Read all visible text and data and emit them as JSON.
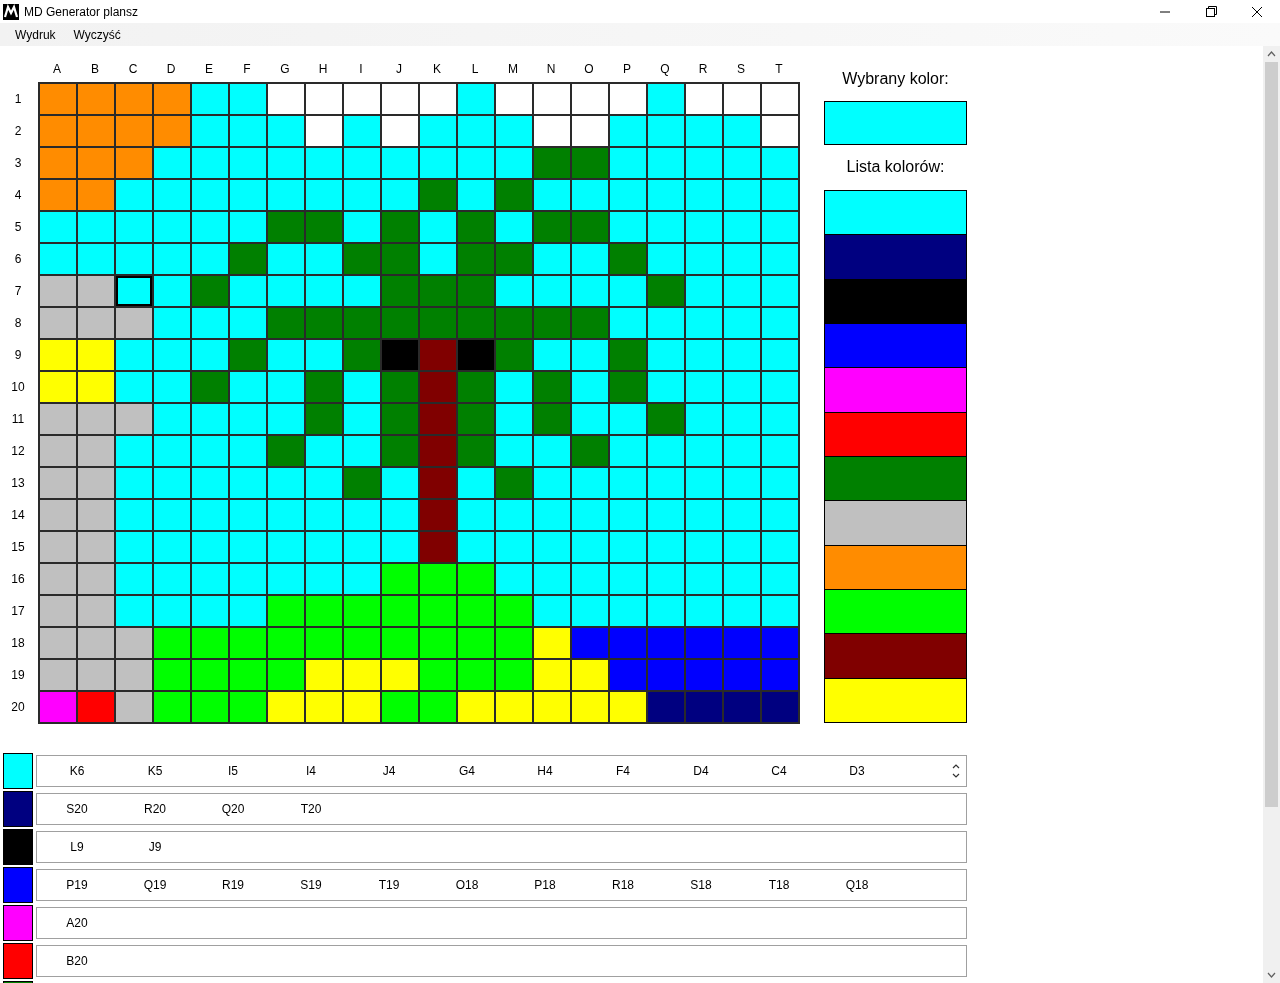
{
  "window": {
    "title": "MD Generator plansz"
  },
  "menu": [
    {
      "label": "Wydruk"
    },
    {
      "label": "Wyczyść"
    }
  ],
  "board": {
    "columns": [
      "A",
      "B",
      "C",
      "D",
      "E",
      "F",
      "G",
      "H",
      "I",
      "J",
      "K",
      "L",
      "M",
      "N",
      "O",
      "P",
      "Q",
      "R",
      "S",
      "T"
    ],
    "rows": [
      {
        "label": "1",
        "cells": [
          {
            "color": "#ff8c00",
            "selected": false
          },
          {
            "color": "#ff8c00",
            "selected": false
          },
          {
            "color": "#ff8c00",
            "selected": false
          },
          {
            "color": "#ff8c00",
            "selected": false
          },
          {
            "color": "#00ffff",
            "selected": false
          },
          {
            "color": "#00ffff",
            "selected": false
          },
          {
            "color": "#ffffff",
            "selected": false
          },
          {
            "color": "#ffffff",
            "selected": false
          },
          {
            "color": "#ffffff",
            "selected": false
          },
          {
            "color": "#ffffff",
            "selected": false
          },
          {
            "color": "#ffffff",
            "selected": false
          },
          {
            "color": "#00ffff",
            "selected": false
          },
          {
            "color": "#ffffff",
            "selected": false
          },
          {
            "color": "#ffffff",
            "selected": false
          },
          {
            "color": "#ffffff",
            "selected": false
          },
          {
            "color": "#ffffff",
            "selected": false
          },
          {
            "color": "#00ffff",
            "selected": false
          },
          {
            "color": "#ffffff",
            "selected": false
          },
          {
            "color": "#ffffff",
            "selected": false
          },
          {
            "color": "#ffffff",
            "selected": false
          }
        ]
      },
      {
        "label": "2",
        "cells": [
          {
            "color": "#ff8c00",
            "selected": false
          },
          {
            "color": "#ff8c00",
            "selected": false
          },
          {
            "color": "#ff8c00",
            "selected": false
          },
          {
            "color": "#ff8c00",
            "selected": false
          },
          {
            "color": "#00ffff",
            "selected": false
          },
          {
            "color": "#00ffff",
            "selected": false
          },
          {
            "color": "#00ffff",
            "selected": false
          },
          {
            "color": "#ffffff",
            "selected": false
          },
          {
            "color": "#00ffff",
            "selected": false
          },
          {
            "color": "#ffffff",
            "selected": false
          },
          {
            "color": "#00ffff",
            "selected": false
          },
          {
            "color": "#00ffff",
            "selected": false
          },
          {
            "color": "#00ffff",
            "selected": false
          },
          {
            "color": "#ffffff",
            "selected": false
          },
          {
            "color": "#ffffff",
            "selected": false
          },
          {
            "color": "#00ffff",
            "selected": false
          },
          {
            "color": "#00ffff",
            "selected": false
          },
          {
            "color": "#00ffff",
            "selected": false
          },
          {
            "color": "#00ffff",
            "selected": false
          },
          {
            "color": "#ffffff",
            "selected": false
          }
        ]
      },
      {
        "label": "3",
        "cells": [
          {
            "color": "#ff8c00",
            "selected": false
          },
          {
            "color": "#ff8c00",
            "selected": false
          },
          {
            "color": "#ff8c00",
            "selected": false
          },
          {
            "color": "#00ffff",
            "selected": false
          },
          {
            "color": "#00ffff",
            "selected": false
          },
          {
            "color": "#00ffff",
            "selected": false
          },
          {
            "color": "#00ffff",
            "selected": false
          },
          {
            "color": "#00ffff",
            "selected": false
          },
          {
            "color": "#00ffff",
            "selected": false
          },
          {
            "color": "#00ffff",
            "selected": false
          },
          {
            "color": "#00ffff",
            "selected": false
          },
          {
            "color": "#00ffff",
            "selected": false
          },
          {
            "color": "#00ffff",
            "selected": false
          },
          {
            "color": "#008000",
            "selected": false
          },
          {
            "color": "#008000",
            "selected": false
          },
          {
            "color": "#00ffff",
            "selected": false
          },
          {
            "color": "#00ffff",
            "selected": false
          },
          {
            "color": "#00ffff",
            "selected": false
          },
          {
            "color": "#00ffff",
            "selected": false
          },
          {
            "color": "#00ffff",
            "selected": false
          }
        ]
      },
      {
        "label": "4",
        "cells": [
          {
            "color": "#ff8c00",
            "selected": false
          },
          {
            "color": "#ff8c00",
            "selected": false
          },
          {
            "color": "#00ffff",
            "selected": false
          },
          {
            "color": "#00ffff",
            "selected": false
          },
          {
            "color": "#00ffff",
            "selected": false
          },
          {
            "color": "#00ffff",
            "selected": false
          },
          {
            "color": "#00ffff",
            "selected": false
          },
          {
            "color": "#00ffff",
            "selected": false
          },
          {
            "color": "#00ffff",
            "selected": false
          },
          {
            "color": "#00ffff",
            "selected": false
          },
          {
            "color": "#008000",
            "selected": false
          },
          {
            "color": "#00ffff",
            "selected": false
          },
          {
            "color": "#008000",
            "selected": false
          },
          {
            "color": "#00ffff",
            "selected": false
          },
          {
            "color": "#00ffff",
            "selected": false
          },
          {
            "color": "#00ffff",
            "selected": false
          },
          {
            "color": "#00ffff",
            "selected": false
          },
          {
            "color": "#00ffff",
            "selected": false
          },
          {
            "color": "#00ffff",
            "selected": false
          },
          {
            "color": "#00ffff",
            "selected": false
          }
        ]
      },
      {
        "label": "5",
        "cells": [
          {
            "color": "#00ffff",
            "selected": false
          },
          {
            "color": "#00ffff",
            "selected": false
          },
          {
            "color": "#00ffff",
            "selected": false
          },
          {
            "color": "#00ffff",
            "selected": false
          },
          {
            "color": "#00ffff",
            "selected": false
          },
          {
            "color": "#00ffff",
            "selected": false
          },
          {
            "color": "#008000",
            "selected": false
          },
          {
            "color": "#008000",
            "selected": false
          },
          {
            "color": "#00ffff",
            "selected": false
          },
          {
            "color": "#008000",
            "selected": false
          },
          {
            "color": "#00ffff",
            "selected": false
          },
          {
            "color": "#008000",
            "selected": false
          },
          {
            "color": "#00ffff",
            "selected": false
          },
          {
            "color": "#008000",
            "selected": false
          },
          {
            "color": "#008000",
            "selected": false
          },
          {
            "color": "#00ffff",
            "selected": false
          },
          {
            "color": "#00ffff",
            "selected": false
          },
          {
            "color": "#00ffff",
            "selected": false
          },
          {
            "color": "#00ffff",
            "selected": false
          },
          {
            "color": "#00ffff",
            "selected": false
          }
        ]
      },
      {
        "label": "6",
        "cells": [
          {
            "color": "#00ffff",
            "selected": false
          },
          {
            "color": "#00ffff",
            "selected": false
          },
          {
            "color": "#00ffff",
            "selected": false
          },
          {
            "color": "#00ffff",
            "selected": false
          },
          {
            "color": "#00ffff",
            "selected": false
          },
          {
            "color": "#008000",
            "selected": false
          },
          {
            "color": "#00ffff",
            "selected": false
          },
          {
            "color": "#00ffff",
            "selected": false
          },
          {
            "color": "#008000",
            "selected": false
          },
          {
            "color": "#008000",
            "selected": false
          },
          {
            "color": "#00ffff",
            "selected": false
          },
          {
            "color": "#008000",
            "selected": false
          },
          {
            "color": "#008000",
            "selected": false
          },
          {
            "color": "#00ffff",
            "selected": false
          },
          {
            "color": "#00ffff",
            "selected": false
          },
          {
            "color": "#008000",
            "selected": false
          },
          {
            "color": "#00ffff",
            "selected": false
          },
          {
            "color": "#00ffff",
            "selected": false
          },
          {
            "color": "#00ffff",
            "selected": false
          },
          {
            "color": "#00ffff",
            "selected": false
          }
        ]
      },
      {
        "label": "7",
        "cells": [
          {
            "color": "#c0c0c0",
            "selected": false
          },
          {
            "color": "#c0c0c0",
            "selected": false
          },
          {
            "color": "#00ffff",
            "selected": true
          },
          {
            "color": "#00ffff",
            "selected": false
          },
          {
            "color": "#008000",
            "selected": false
          },
          {
            "color": "#00ffff",
            "selected": false
          },
          {
            "color": "#00ffff",
            "selected": false
          },
          {
            "color": "#00ffff",
            "selected": false
          },
          {
            "color": "#00ffff",
            "selected": false
          },
          {
            "color": "#008000",
            "selected": false
          },
          {
            "color": "#008000",
            "selected": false
          },
          {
            "color": "#008000",
            "selected": false
          },
          {
            "color": "#00ffff",
            "selected": false
          },
          {
            "color": "#00ffff",
            "selected": false
          },
          {
            "color": "#00ffff",
            "selected": false
          },
          {
            "color": "#00ffff",
            "selected": false
          },
          {
            "color": "#008000",
            "selected": false
          },
          {
            "color": "#00ffff",
            "selected": false
          },
          {
            "color": "#00ffff",
            "selected": false
          },
          {
            "color": "#00ffff",
            "selected": false
          }
        ]
      },
      {
        "label": "8",
        "cells": [
          {
            "color": "#c0c0c0",
            "selected": false
          },
          {
            "color": "#c0c0c0",
            "selected": false
          },
          {
            "color": "#c0c0c0",
            "selected": false
          },
          {
            "color": "#00ffff",
            "selected": false
          },
          {
            "color": "#00ffff",
            "selected": false
          },
          {
            "color": "#00ffff",
            "selected": false
          },
          {
            "color": "#008000",
            "selected": false
          },
          {
            "color": "#008000",
            "selected": false
          },
          {
            "color": "#008000",
            "selected": false
          },
          {
            "color": "#008000",
            "selected": false
          },
          {
            "color": "#008000",
            "selected": false
          },
          {
            "color": "#008000",
            "selected": false
          },
          {
            "color": "#008000",
            "selected": false
          },
          {
            "color": "#008000",
            "selected": false
          },
          {
            "color": "#008000",
            "selected": false
          },
          {
            "color": "#00ffff",
            "selected": false
          },
          {
            "color": "#00ffff",
            "selected": false
          },
          {
            "color": "#00ffff",
            "selected": false
          },
          {
            "color": "#00ffff",
            "selected": false
          },
          {
            "color": "#00ffff",
            "selected": false
          }
        ]
      },
      {
        "label": "9",
        "cells": [
          {
            "color": "#ffff00",
            "selected": false
          },
          {
            "color": "#ffff00",
            "selected": false
          },
          {
            "color": "#00ffff",
            "selected": false
          },
          {
            "color": "#00ffff",
            "selected": false
          },
          {
            "color": "#00ffff",
            "selected": false
          },
          {
            "color": "#008000",
            "selected": false
          },
          {
            "color": "#00ffff",
            "selected": false
          },
          {
            "color": "#00ffff",
            "selected": false
          },
          {
            "color": "#008000",
            "selected": false
          },
          {
            "color": "#000000",
            "selected": false
          },
          {
            "color": "#800000",
            "selected": false
          },
          {
            "color": "#000000",
            "selected": false
          },
          {
            "color": "#008000",
            "selected": false
          },
          {
            "color": "#00ffff",
            "selected": false
          },
          {
            "color": "#00ffff",
            "selected": false
          },
          {
            "color": "#008000",
            "selected": false
          },
          {
            "color": "#00ffff",
            "selected": false
          },
          {
            "color": "#00ffff",
            "selected": false
          },
          {
            "color": "#00ffff",
            "selected": false
          },
          {
            "color": "#00ffff",
            "selected": false
          }
        ]
      },
      {
        "label": "10",
        "cells": [
          {
            "color": "#ffff00",
            "selected": false
          },
          {
            "color": "#ffff00",
            "selected": false
          },
          {
            "color": "#00ffff",
            "selected": false
          },
          {
            "color": "#00ffff",
            "selected": false
          },
          {
            "color": "#008000",
            "selected": false
          },
          {
            "color": "#00ffff",
            "selected": false
          },
          {
            "color": "#00ffff",
            "selected": false
          },
          {
            "color": "#008000",
            "selected": false
          },
          {
            "color": "#00ffff",
            "selected": false
          },
          {
            "color": "#008000",
            "selected": false
          },
          {
            "color": "#800000",
            "selected": false
          },
          {
            "color": "#008000",
            "selected": false
          },
          {
            "color": "#00ffff",
            "selected": false
          },
          {
            "color": "#008000",
            "selected": false
          },
          {
            "color": "#00ffff",
            "selected": false
          },
          {
            "color": "#008000",
            "selected": false
          },
          {
            "color": "#00ffff",
            "selected": false
          },
          {
            "color": "#00ffff",
            "selected": false
          },
          {
            "color": "#00ffff",
            "selected": false
          },
          {
            "color": "#00ffff",
            "selected": false
          }
        ]
      },
      {
        "label": "11",
        "cells": [
          {
            "color": "#c0c0c0",
            "selected": false
          },
          {
            "color": "#c0c0c0",
            "selected": false
          },
          {
            "color": "#c0c0c0",
            "selected": false
          },
          {
            "color": "#00ffff",
            "selected": false
          },
          {
            "color": "#00ffff",
            "selected": false
          },
          {
            "color": "#00ffff",
            "selected": false
          },
          {
            "color": "#00ffff",
            "selected": false
          },
          {
            "color": "#008000",
            "selected": false
          },
          {
            "color": "#00ffff",
            "selected": false
          },
          {
            "color": "#008000",
            "selected": false
          },
          {
            "color": "#800000",
            "selected": false
          },
          {
            "color": "#008000",
            "selected": false
          },
          {
            "color": "#00ffff",
            "selected": false
          },
          {
            "color": "#008000",
            "selected": false
          },
          {
            "color": "#00ffff",
            "selected": false
          },
          {
            "color": "#00ffff",
            "selected": false
          },
          {
            "color": "#008000",
            "selected": false
          },
          {
            "color": "#00ffff",
            "selected": false
          },
          {
            "color": "#00ffff",
            "selected": false
          },
          {
            "color": "#00ffff",
            "selected": false
          }
        ]
      },
      {
        "label": "12",
        "cells": [
          {
            "color": "#c0c0c0",
            "selected": false
          },
          {
            "color": "#c0c0c0",
            "selected": false
          },
          {
            "color": "#00ffff",
            "selected": false
          },
          {
            "color": "#00ffff",
            "selected": false
          },
          {
            "color": "#00ffff",
            "selected": false
          },
          {
            "color": "#00ffff",
            "selected": false
          },
          {
            "color": "#008000",
            "selected": false
          },
          {
            "color": "#00ffff",
            "selected": false
          },
          {
            "color": "#00ffff",
            "selected": false
          },
          {
            "color": "#008000",
            "selected": false
          },
          {
            "color": "#800000",
            "selected": false
          },
          {
            "color": "#008000",
            "selected": false
          },
          {
            "color": "#00ffff",
            "selected": false
          },
          {
            "color": "#00ffff",
            "selected": false
          },
          {
            "color": "#008000",
            "selected": false
          },
          {
            "color": "#00ffff",
            "selected": false
          },
          {
            "color": "#00ffff",
            "selected": false
          },
          {
            "color": "#00ffff",
            "selected": false
          },
          {
            "color": "#00ffff",
            "selected": false
          },
          {
            "color": "#00ffff",
            "selected": false
          }
        ]
      },
      {
        "label": "13",
        "cells": [
          {
            "color": "#c0c0c0",
            "selected": false
          },
          {
            "color": "#c0c0c0",
            "selected": false
          },
          {
            "color": "#00ffff",
            "selected": false
          },
          {
            "color": "#00ffff",
            "selected": false
          },
          {
            "color": "#00ffff",
            "selected": false
          },
          {
            "color": "#00ffff",
            "selected": false
          },
          {
            "color": "#00ffff",
            "selected": false
          },
          {
            "color": "#00ffff",
            "selected": false
          },
          {
            "color": "#008000",
            "selected": false
          },
          {
            "color": "#00ffff",
            "selected": false
          },
          {
            "color": "#800000",
            "selected": false
          },
          {
            "color": "#00ffff",
            "selected": false
          },
          {
            "color": "#008000",
            "selected": false
          },
          {
            "color": "#00ffff",
            "selected": false
          },
          {
            "color": "#00ffff",
            "selected": false
          },
          {
            "color": "#00ffff",
            "selected": false
          },
          {
            "color": "#00ffff",
            "selected": false
          },
          {
            "color": "#00ffff",
            "selected": false
          },
          {
            "color": "#00ffff",
            "selected": false
          },
          {
            "color": "#00ffff",
            "selected": false
          }
        ]
      },
      {
        "label": "14",
        "cells": [
          {
            "color": "#c0c0c0",
            "selected": false
          },
          {
            "color": "#c0c0c0",
            "selected": false
          },
          {
            "color": "#00ffff",
            "selected": false
          },
          {
            "color": "#00ffff",
            "selected": false
          },
          {
            "color": "#00ffff",
            "selected": false
          },
          {
            "color": "#00ffff",
            "selected": false
          },
          {
            "color": "#00ffff",
            "selected": false
          },
          {
            "color": "#00ffff",
            "selected": false
          },
          {
            "color": "#00ffff",
            "selected": false
          },
          {
            "color": "#00ffff",
            "selected": false
          },
          {
            "color": "#800000",
            "selected": false
          },
          {
            "color": "#00ffff",
            "selected": false
          },
          {
            "color": "#00ffff",
            "selected": false
          },
          {
            "color": "#00ffff",
            "selected": false
          },
          {
            "color": "#00ffff",
            "selected": false
          },
          {
            "color": "#00ffff",
            "selected": false
          },
          {
            "color": "#00ffff",
            "selected": false
          },
          {
            "color": "#00ffff",
            "selected": false
          },
          {
            "color": "#00ffff",
            "selected": false
          },
          {
            "color": "#00ffff",
            "selected": false
          }
        ]
      },
      {
        "label": "15",
        "cells": [
          {
            "color": "#c0c0c0",
            "selected": false
          },
          {
            "color": "#c0c0c0",
            "selected": false
          },
          {
            "color": "#00ffff",
            "selected": false
          },
          {
            "color": "#00ffff",
            "selected": false
          },
          {
            "color": "#00ffff",
            "selected": false
          },
          {
            "color": "#00ffff",
            "selected": false
          },
          {
            "color": "#00ffff",
            "selected": false
          },
          {
            "color": "#00ffff",
            "selected": false
          },
          {
            "color": "#00ffff",
            "selected": false
          },
          {
            "color": "#00ffff",
            "selected": false
          },
          {
            "color": "#800000",
            "selected": false
          },
          {
            "color": "#00ffff",
            "selected": false
          },
          {
            "color": "#00ffff",
            "selected": false
          },
          {
            "color": "#00ffff",
            "selected": false
          },
          {
            "color": "#00ffff",
            "selected": false
          },
          {
            "color": "#00ffff",
            "selected": false
          },
          {
            "color": "#00ffff",
            "selected": false
          },
          {
            "color": "#00ffff",
            "selected": false
          },
          {
            "color": "#00ffff",
            "selected": false
          },
          {
            "color": "#00ffff",
            "selected": false
          }
        ]
      },
      {
        "label": "16",
        "cells": [
          {
            "color": "#c0c0c0",
            "selected": false
          },
          {
            "color": "#c0c0c0",
            "selected": false
          },
          {
            "color": "#00ffff",
            "selected": false
          },
          {
            "color": "#00ffff",
            "selected": false
          },
          {
            "color": "#00ffff",
            "selected": false
          },
          {
            "color": "#00ffff",
            "selected": false
          },
          {
            "color": "#00ffff",
            "selected": false
          },
          {
            "color": "#00ffff",
            "selected": false
          },
          {
            "color": "#00ffff",
            "selected": false
          },
          {
            "color": "#00ff00",
            "selected": false
          },
          {
            "color": "#00ff00",
            "selected": false
          },
          {
            "color": "#00ff00",
            "selected": false
          },
          {
            "color": "#00ffff",
            "selected": false
          },
          {
            "color": "#00ffff",
            "selected": false
          },
          {
            "color": "#00ffff",
            "selected": false
          },
          {
            "color": "#00ffff",
            "selected": false
          },
          {
            "color": "#00ffff",
            "selected": false
          },
          {
            "color": "#00ffff",
            "selected": false
          },
          {
            "color": "#00ffff",
            "selected": false
          },
          {
            "color": "#00ffff",
            "selected": false
          }
        ]
      },
      {
        "label": "17",
        "cells": [
          {
            "color": "#c0c0c0",
            "selected": false
          },
          {
            "color": "#c0c0c0",
            "selected": false
          },
          {
            "color": "#00ffff",
            "selected": false
          },
          {
            "color": "#00ffff",
            "selected": false
          },
          {
            "color": "#00ffff",
            "selected": false
          },
          {
            "color": "#00ffff",
            "selected": false
          },
          {
            "color": "#00ff00",
            "selected": false
          },
          {
            "color": "#00ff00",
            "selected": false
          },
          {
            "color": "#00ff00",
            "selected": false
          },
          {
            "color": "#00ff00",
            "selected": false
          },
          {
            "color": "#00ff00",
            "selected": false
          },
          {
            "color": "#00ff00",
            "selected": false
          },
          {
            "color": "#00ff00",
            "selected": false
          },
          {
            "color": "#00ffff",
            "selected": false
          },
          {
            "color": "#00ffff",
            "selected": false
          },
          {
            "color": "#00ffff",
            "selected": false
          },
          {
            "color": "#00ffff",
            "selected": false
          },
          {
            "color": "#00ffff",
            "selected": false
          },
          {
            "color": "#00ffff",
            "selected": false
          },
          {
            "color": "#00ffff",
            "selected": false
          }
        ]
      },
      {
        "label": "18",
        "cells": [
          {
            "color": "#c0c0c0",
            "selected": false
          },
          {
            "color": "#c0c0c0",
            "selected": false
          },
          {
            "color": "#c0c0c0",
            "selected": false
          },
          {
            "color": "#00ff00",
            "selected": false
          },
          {
            "color": "#00ff00",
            "selected": false
          },
          {
            "color": "#00ff00",
            "selected": false
          },
          {
            "color": "#00ff00",
            "selected": false
          },
          {
            "color": "#00ff00",
            "selected": false
          },
          {
            "color": "#00ff00",
            "selected": false
          },
          {
            "color": "#00ff00",
            "selected": false
          },
          {
            "color": "#00ff00",
            "selected": false
          },
          {
            "color": "#00ff00",
            "selected": false
          },
          {
            "color": "#00ff00",
            "selected": false
          },
          {
            "color": "#ffff00",
            "selected": false
          },
          {
            "color": "#0000ff",
            "selected": false
          },
          {
            "color": "#0000ff",
            "selected": false
          },
          {
            "color": "#0000ff",
            "selected": false
          },
          {
            "color": "#0000ff",
            "selected": false
          },
          {
            "color": "#0000ff",
            "selected": false
          },
          {
            "color": "#0000ff",
            "selected": false
          }
        ]
      },
      {
        "label": "19",
        "cells": [
          {
            "color": "#c0c0c0",
            "selected": false
          },
          {
            "color": "#c0c0c0",
            "selected": false
          },
          {
            "color": "#c0c0c0",
            "selected": false
          },
          {
            "color": "#00ff00",
            "selected": false
          },
          {
            "color": "#00ff00",
            "selected": false
          },
          {
            "color": "#00ff00",
            "selected": false
          },
          {
            "color": "#00ff00",
            "selected": false
          },
          {
            "color": "#ffff00",
            "selected": false
          },
          {
            "color": "#ffff00",
            "selected": false
          },
          {
            "color": "#ffff00",
            "selected": false
          },
          {
            "color": "#00ff00",
            "selected": false
          },
          {
            "color": "#00ff00",
            "selected": false
          },
          {
            "color": "#00ff00",
            "selected": false
          },
          {
            "color": "#ffff00",
            "selected": false
          },
          {
            "color": "#ffff00",
            "selected": false
          },
          {
            "color": "#0000ff",
            "selected": false
          },
          {
            "color": "#0000ff",
            "selected": false
          },
          {
            "color": "#0000ff",
            "selected": false
          },
          {
            "color": "#0000ff",
            "selected": false
          },
          {
            "color": "#0000ff",
            "selected": false
          }
        ]
      },
      {
        "label": "20",
        "cells": [
          {
            "color": "#ff00ff",
            "selected": false
          },
          {
            "color": "#ff0000",
            "selected": false
          },
          {
            "color": "#c0c0c0",
            "selected": false
          },
          {
            "color": "#00ff00",
            "selected": false
          },
          {
            "color": "#00ff00",
            "selected": false
          },
          {
            "color": "#00ff00",
            "selected": false
          },
          {
            "color": "#ffff00",
            "selected": false
          },
          {
            "color": "#ffff00",
            "selected": false
          },
          {
            "color": "#ffff00",
            "selected": false
          },
          {
            "color": "#00ff00",
            "selected": false
          },
          {
            "color": "#00ff00",
            "selected": false
          },
          {
            "color": "#ffff00",
            "selected": false
          },
          {
            "color": "#ffff00",
            "selected": false
          },
          {
            "color": "#ffff00",
            "selected": false
          },
          {
            "color": "#ffff00",
            "selected": false
          },
          {
            "color": "#ffff00",
            "selected": false
          },
          {
            "color": "#000080",
            "selected": false
          },
          {
            "color": "#000080",
            "selected": false
          },
          {
            "color": "#000080",
            "selected": false
          },
          {
            "color": "#000080",
            "selected": false
          }
        ]
      }
    ]
  },
  "side_panel": {
    "selected_label": "Wybrany kolor:",
    "chosen": {
      "color": "#00ffff"
    },
    "palette_label": "Lista kolorów:",
    "palette": [
      {
        "color": "#00ffff"
      },
      {
        "color": "#000080"
      },
      {
        "color": "#000000"
      },
      {
        "color": "#0000ff"
      },
      {
        "color": "#ff00ff"
      },
      {
        "color": "#ff0000"
      },
      {
        "color": "#008000"
      },
      {
        "color": "#c0c0c0"
      },
      {
        "color": "#ff8c00"
      },
      {
        "color": "#00ff00"
      },
      {
        "color": "#800000"
      },
      {
        "color": "#ffff00"
      }
    ]
  },
  "color_lists": [
    {
      "color": "#00ffff",
      "scroll_arrows": true,
      "cells": [
        "K6",
        "K5",
        "I5",
        "I4",
        "J4",
        "G4",
        "H4",
        "F4",
        "D4",
        "C4",
        "D3"
      ]
    },
    {
      "color": "#000080",
      "scroll_arrows": false,
      "cells": [
        "S20",
        "R20",
        "Q20",
        "T20"
      ]
    },
    {
      "color": "#000000",
      "scroll_arrows": false,
      "cells": [
        "L9",
        "J9"
      ]
    },
    {
      "color": "#0000ff",
      "scroll_arrows": false,
      "cells": [
        "P19",
        "Q19",
        "R19",
        "S19",
        "T19",
        "O18",
        "P18",
        "R18",
        "S18",
        "T18",
        "Q18"
      ]
    },
    {
      "color": "#ff00ff",
      "scroll_arrows": false,
      "cells": [
        "A20"
      ]
    },
    {
      "color": "#ff0000",
      "scroll_arrows": false,
      "cells": [
        "B20"
      ]
    },
    {
      "color": "#008000"
    }
  ]
}
